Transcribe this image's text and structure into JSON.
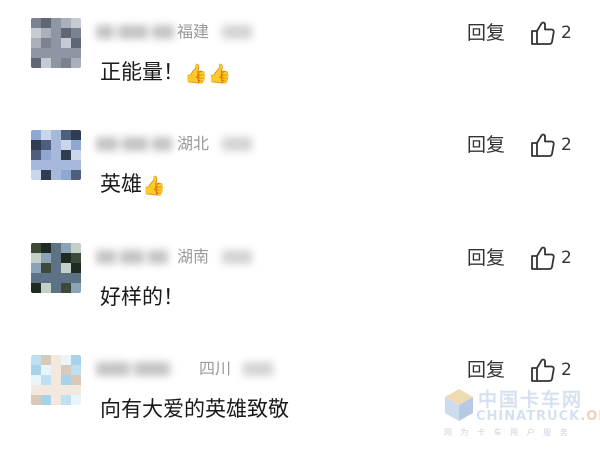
{
  "comments": [
    {
      "region": "福建",
      "text": "正能量！",
      "emoji": "👍👍",
      "reply_label": "回复",
      "likes": "2",
      "avatar_colors": [
        "#7c8290",
        "#a9afbb",
        "#5f6675",
        "#c6cad2",
        "#8e95a3"
      ]
    },
    {
      "region": "湖北",
      "text": "英雄",
      "emoji": "👍",
      "reply_label": "回复",
      "likes": "2",
      "avatar_colors": [
        "#8fa8d2",
        "#4d5f7c",
        "#c9d6ec",
        "#2f3c52",
        "#a6b9db"
      ]
    },
    {
      "region": "湖南",
      "text": "好样的！",
      "emoji": "",
      "reply_label": "回复",
      "likes": "2",
      "avatar_colors": [
        "#3d4a3a",
        "#8aa3b8",
        "#1f2a22",
        "#c4cfc8",
        "#5d7385"
      ]
    },
    {
      "region": "四川",
      "text": "向有大爱的英雄致敬",
      "emoji": "",
      "reply_label": "回复",
      "likes": "2",
      "avatar_colors": [
        "#bfe0f2",
        "#e9f5fb",
        "#d8c9b8",
        "#a7d3ea",
        "#f2e8de"
      ]
    }
  ],
  "watermark": {
    "cn": "中国卡车网",
    "en_main": "CHINATRUCK",
    "en_org": ".ORG",
    "sub": "网 为 卡 车 用 户 服 务"
  },
  "colors": {
    "text": "#1a1a1a",
    "meta": "#9a9a9a",
    "action": "#333333"
  }
}
